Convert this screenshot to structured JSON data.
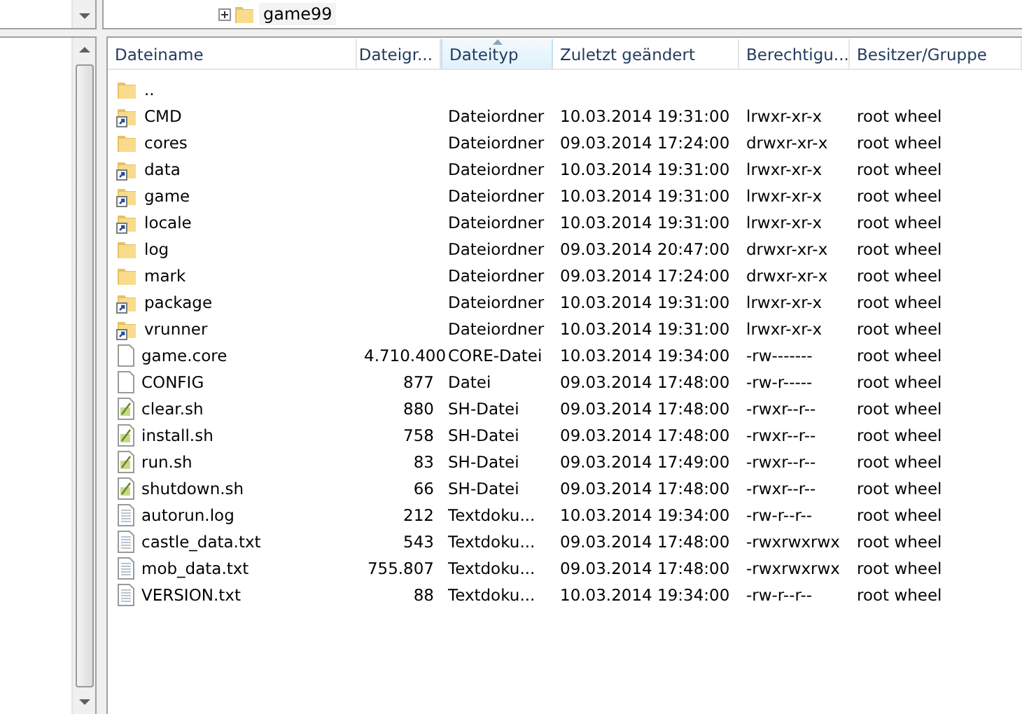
{
  "tree": {
    "items": [
      {
        "label": "game99",
        "expanded": false
      }
    ]
  },
  "table": {
    "columns": [
      {
        "label": "Dateiname",
        "sorted": false
      },
      {
        "label": "Dateigr...",
        "sorted": false
      },
      {
        "label": "Dateityp",
        "sorted": true
      },
      {
        "label": "Zuletzt geändert",
        "sorted": false
      },
      {
        "label": "Berechtigu...",
        "sorted": false
      },
      {
        "label": "Besitzer/Gruppe",
        "sorted": false
      }
    ],
    "rows": [
      {
        "kind": "folder",
        "name": ".."
      },
      {
        "kind": "folder_link",
        "name": "CMD",
        "type": "Dateiordner",
        "modified": "10.03.2014 19:31:00",
        "permissions": "lrwxr-xr-x",
        "owner": "root wheel"
      },
      {
        "kind": "folder",
        "name": "cores",
        "type": "Dateiordner",
        "modified": "09.03.2014 17:24:00",
        "permissions": "drwxr-xr-x",
        "owner": "root wheel"
      },
      {
        "kind": "folder_link",
        "name": "data",
        "type": "Dateiordner",
        "modified": "10.03.2014 19:31:00",
        "permissions": "lrwxr-xr-x",
        "owner": "root wheel"
      },
      {
        "kind": "folder_link",
        "name": "game",
        "type": "Dateiordner",
        "modified": "10.03.2014 19:31:00",
        "permissions": "lrwxr-xr-x",
        "owner": "root wheel"
      },
      {
        "kind": "folder_link",
        "name": "locale",
        "type": "Dateiordner",
        "modified": "10.03.2014 19:31:00",
        "permissions": "lrwxr-xr-x",
        "owner": "root wheel"
      },
      {
        "kind": "folder",
        "name": "log",
        "type": "Dateiordner",
        "modified": "09.03.2014 20:47:00",
        "permissions": "drwxr-xr-x",
        "owner": "root wheel"
      },
      {
        "kind": "folder",
        "name": "mark",
        "type": "Dateiordner",
        "modified": "09.03.2014 17:24:00",
        "permissions": "drwxr-xr-x",
        "owner": "root wheel"
      },
      {
        "kind": "folder_link",
        "name": "package",
        "type": "Dateiordner",
        "modified": "10.03.2014 19:31:00",
        "permissions": "lrwxr-xr-x",
        "owner": "root wheel"
      },
      {
        "kind": "folder_link",
        "name": "vrunner",
        "type": "Dateiordner",
        "modified": "10.03.2014 19:31:00",
        "permissions": "lrwxr-xr-x",
        "owner": "root wheel"
      },
      {
        "kind": "file",
        "name": "game.core",
        "size": "4.710.400",
        "type": "CORE-Datei",
        "modified": "10.03.2014 19:34:00",
        "permissions": "-rw-------",
        "owner": "root wheel"
      },
      {
        "kind": "file",
        "name": "CONFIG",
        "size": "877",
        "type": "Datei",
        "modified": "09.03.2014 17:48:00",
        "permissions": "-rw-r-----",
        "owner": "root wheel"
      },
      {
        "kind": "script",
        "name": "clear.sh",
        "size": "880",
        "type": "SH-Datei",
        "modified": "09.03.2014 17:48:00",
        "permissions": "-rwxr--r--",
        "owner": "root wheel"
      },
      {
        "kind": "script",
        "name": "install.sh",
        "size": "758",
        "type": "SH-Datei",
        "modified": "09.03.2014 17:48:00",
        "permissions": "-rwxr--r--",
        "owner": "root wheel"
      },
      {
        "kind": "script",
        "name": "run.sh",
        "size": "83",
        "type": "SH-Datei",
        "modified": "09.03.2014 17:49:00",
        "permissions": "-rwxr--r--",
        "owner": "root wheel"
      },
      {
        "kind": "script",
        "name": "shutdown.sh",
        "size": "66",
        "type": "SH-Datei",
        "modified": "09.03.2014 17:48:00",
        "permissions": "-rwxr--r--",
        "owner": "root wheel"
      },
      {
        "kind": "text",
        "name": "autorun.log",
        "size": "212",
        "type": "Textdoku...",
        "modified": "10.03.2014 19:34:00",
        "permissions": "-rw-r--r--",
        "owner": "root wheel"
      },
      {
        "kind": "text",
        "name": "castle_data.txt",
        "size": "543",
        "type": "Textdoku...",
        "modified": "09.03.2014 17:48:00",
        "permissions": "-rwxrwxrwx",
        "owner": "root wheel"
      },
      {
        "kind": "text",
        "name": "mob_data.txt",
        "size": "755.807",
        "type": "Textdoku...",
        "modified": "09.03.2014 17:48:00",
        "permissions": "-rwxrwxrwx",
        "owner": "root wheel"
      },
      {
        "kind": "text",
        "name": "VERSION.txt",
        "size": "88",
        "type": "Textdoku...",
        "modified": "10.03.2014 19:34:00",
        "permissions": "-rw-r--r--",
        "owner": "root wheel"
      }
    ]
  }
}
